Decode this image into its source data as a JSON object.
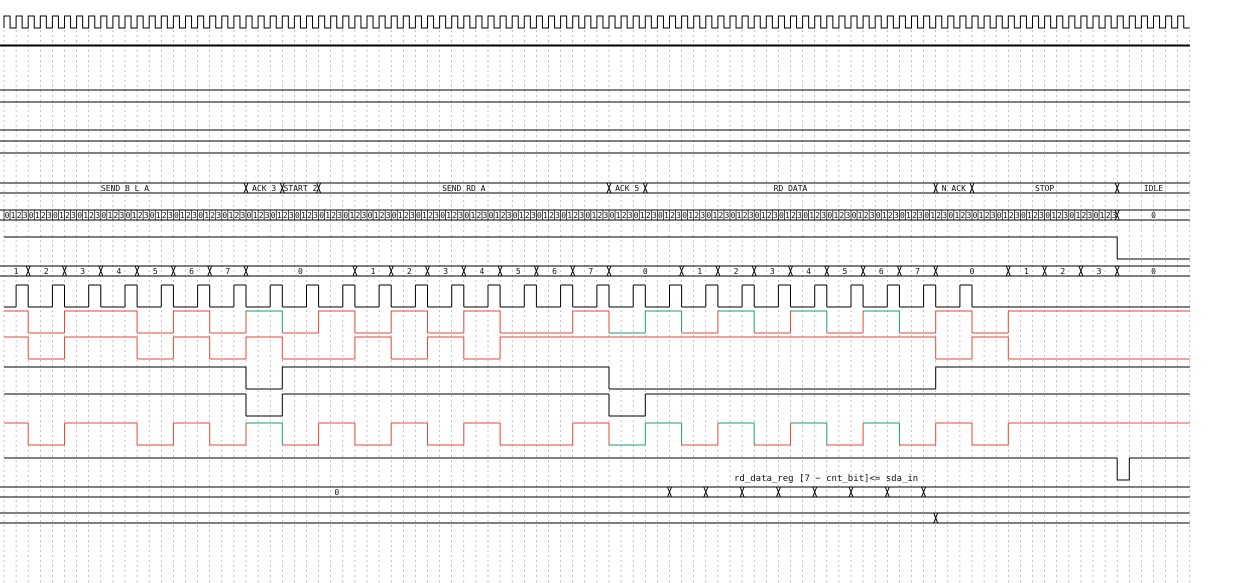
{
  "chart_data": {
    "type": "timing-diagram",
    "x_unit": "sys_clk cycle",
    "total_cycles": 196,
    "colors": {
      "line": "#000000",
      "grid": "#9a9a9a",
      "scl_high": "#e8463a",
      "sda_read": "#1a9e7a"
    },
    "rows": [
      {
        "kind": "clock",
        "name": "sys-clock",
        "period": 2
      },
      {
        "kind": "flat",
        "name": "signal-row-2"
      },
      {
        "kind": "flat",
        "name": "signal-row-3"
      },
      {
        "kind": "flat",
        "name": "signal-row-4"
      },
      {
        "kind": "flat",
        "name": "signal-row-5"
      },
      {
        "kind": "flat",
        "name": "signal-row-6"
      },
      {
        "kind": "flat",
        "name": "signal-row-7"
      },
      {
        "kind": "bus",
        "name": "state-bus",
        "segments": [
          {
            "s": 0,
            "e": 40,
            "v": "SEND_B_L_A"
          },
          {
            "s": 40,
            "e": 46,
            "v": "ACK_3"
          },
          {
            "s": 46,
            "e": 52,
            "v": "START_2"
          },
          {
            "s": 52,
            "e": 100,
            "v": "SEND_RD_A"
          },
          {
            "s": 100,
            "e": 106,
            "v": "ACK_5"
          },
          {
            "s": 106,
            "e": 154,
            "v": "RD_DATA"
          },
          {
            "s": 154,
            "e": 160,
            "v": "N_ACK"
          },
          {
            "s": 160,
            "e": 184,
            "v": "STOP"
          },
          {
            "s": 184,
            "e": 196,
            "v": "IDLE"
          }
        ]
      },
      {
        "kind": "counter",
        "name": "cnt-clk-bus",
        "end": 184,
        "tail": "0"
      },
      {
        "kind": "digital",
        "name": "signal-row-10",
        "init": 1,
        "edges": [
          184
        ]
      },
      {
        "kind": "bus",
        "name": "cnt-bit-bus",
        "segments": [
          {
            "s": 0,
            "e": 4,
            "v": "1"
          },
          {
            "s": 4,
            "e": 10,
            "v": "2"
          },
          {
            "s": 10,
            "e": 16,
            "v": "3"
          },
          {
            "s": 16,
            "e": 22,
            "v": "4"
          },
          {
            "s": 22,
            "e": 28,
            "v": "5"
          },
          {
            "s": 28,
            "e": 34,
            "v": "6"
          },
          {
            "s": 34,
            "e": 40,
            "v": "7"
          },
          {
            "s": 40,
            "e": 58,
            "v": "0"
          },
          {
            "s": 58,
            "e": 64,
            "v": "1"
          },
          {
            "s": 64,
            "e": 70,
            "v": "2"
          },
          {
            "s": 70,
            "e": 76,
            "v": "3"
          },
          {
            "s": 76,
            "e": 82,
            "v": "4"
          },
          {
            "s": 82,
            "e": 88,
            "v": "5"
          },
          {
            "s": 88,
            "e": 94,
            "v": "6"
          },
          {
            "s": 94,
            "e": 100,
            "v": "7"
          },
          {
            "s": 100,
            "e": 112,
            "v": "0"
          },
          {
            "s": 112,
            "e": 118,
            "v": "1"
          },
          {
            "s": 118,
            "e": 124,
            "v": "2"
          },
          {
            "s": 124,
            "e": 130,
            "v": "3"
          },
          {
            "s": 130,
            "e": 136,
            "v": "4"
          },
          {
            "s": 136,
            "e": 142,
            "v": "5"
          },
          {
            "s": 142,
            "e": 148,
            "v": "6"
          },
          {
            "s": 148,
            "e": 154,
            "v": "7"
          },
          {
            "s": 154,
            "e": 166,
            "v": "0"
          },
          {
            "s": 166,
            "e": 172,
            "v": "1"
          },
          {
            "s": 172,
            "e": 178,
            "v": "2"
          },
          {
            "s": 178,
            "e": 184,
            "v": "3"
          },
          {
            "s": 184,
            "e": 196,
            "v": "0"
          }
        ]
      },
      {
        "kind": "digital",
        "name": "scl-signal",
        "init": 0,
        "edges": [
          2,
          4,
          8,
          10,
          14,
          16,
          20,
          22,
          26,
          28,
          32,
          34,
          38,
          40,
          44,
          46,
          50,
          52,
          56,
          58,
          62,
          64,
          68,
          70,
          74,
          76,
          80,
          82,
          86,
          88,
          92,
          94,
          98,
          100,
          104,
          106,
          110,
          112,
          116,
          118,
          122,
          124,
          128,
          130,
          134,
          136,
          140,
          142,
          146,
          148,
          152,
          154,
          158,
          160
        ]
      },
      {
        "kind": "digital",
        "name": "sda-out-signal",
        "init": 1,
        "colored": true,
        "edges": [
          4,
          10,
          22,
          28,
          34,
          40,
          46,
          52,
          58,
          64,
          70,
          76,
          82,
          94,
          100,
          106,
          112,
          118,
          124,
          130,
          136,
          142,
          148,
          154,
          160,
          166
        ],
        "green": [
          [
            40,
            46
          ],
          [
            100,
            112
          ],
          [
            118,
            124
          ],
          [
            130,
            136
          ],
          [
            142,
            148
          ]
        ]
      },
      {
        "kind": "digital",
        "name": "sda-signal",
        "init": 1,
        "colored": true,
        "edges": [
          4,
          10,
          22,
          28,
          34,
          40,
          46,
          58,
          64,
          70,
          76,
          82,
          154,
          160,
          166
        ],
        "green": []
      },
      {
        "kind": "digital",
        "name": "signal-row-14",
        "init": 1,
        "edges": [
          40,
          46,
          100,
          154
        ]
      },
      {
        "kind": "digital",
        "name": "signal-row-15",
        "init": 1,
        "edges": [
          40,
          46,
          100,
          106
        ]
      },
      {
        "kind": "digital",
        "name": "sda-in-signal",
        "init": 1,
        "colored": true,
        "edges": [
          4,
          10,
          22,
          28,
          34,
          40,
          46,
          52,
          58,
          64,
          70,
          76,
          82,
          94,
          100,
          106,
          112,
          118,
          124,
          130,
          136,
          142,
          148,
          154,
          160,
          166
        ],
        "green": [
          [
            40,
            46
          ],
          [
            100,
            112
          ],
          [
            118,
            124
          ],
          [
            130,
            136
          ],
          [
            142,
            148
          ]
        ]
      },
      {
        "kind": "digital",
        "name": "signal-row-17",
        "init": 1,
        "edges": [
          184,
          186
        ]
      },
      {
        "kind": "bus",
        "name": "rd-data-reg-bus",
        "segments": [
          {
            "s": 0,
            "e": 110,
            "v": "0"
          },
          {
            "s": 110,
            "e": 116,
            "v": ""
          },
          {
            "s": 116,
            "e": 122,
            "v": ""
          },
          {
            "s": 122,
            "e": 128,
            "v": ""
          },
          {
            "s": 128,
            "e": 134,
            "v": ""
          },
          {
            "s": 134,
            "e": 140,
            "v": ""
          },
          {
            "s": 140,
            "e": 146,
            "v": ""
          },
          {
            "s": 146,
            "e": 152,
            "v": ""
          },
          {
            "s": 152,
            "e": 196,
            "v": ""
          }
        ]
      },
      {
        "kind": "bus",
        "name": "signal-row-19",
        "segments": [
          {
            "s": 0,
            "e": 154,
            "v": ""
          },
          {
            "s": 154,
            "e": 196,
            "v": ""
          }
        ]
      }
    ]
  },
  "annotation": {
    "text": "rd_data_reg [7 − cnt_bit]<= sda_in"
  }
}
